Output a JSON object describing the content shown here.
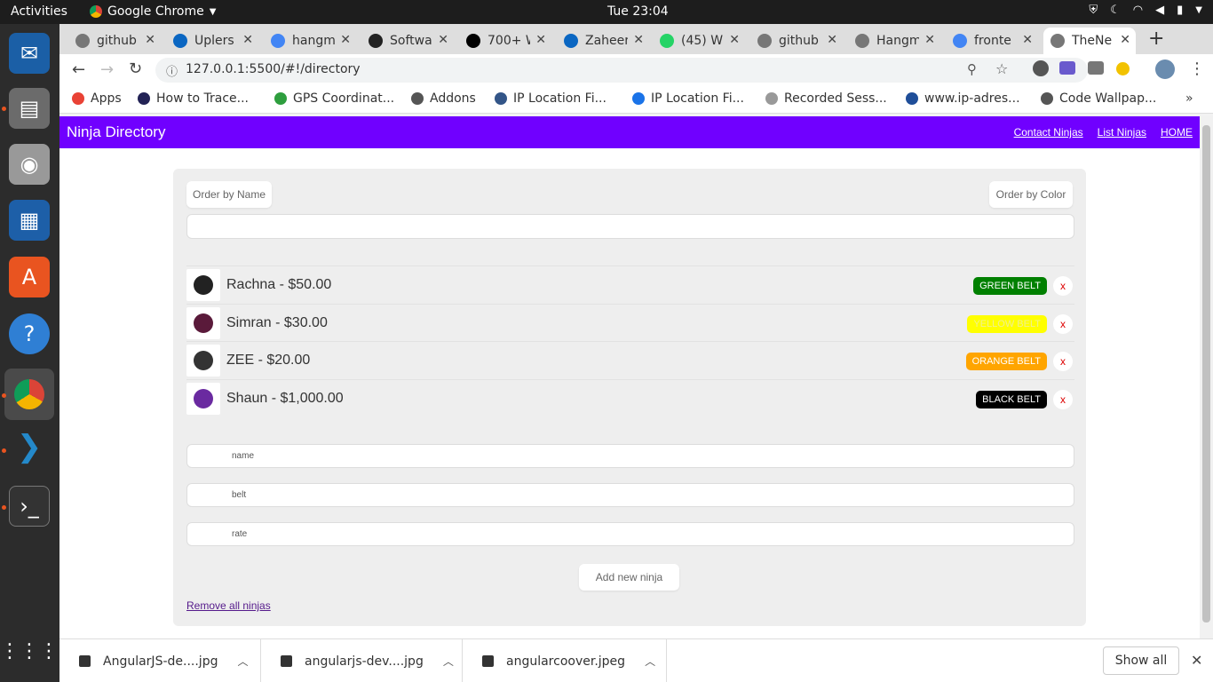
{
  "topbar": {
    "activities": "Activities",
    "app_name": "Google Chrome",
    "clock": "Tue 23:04"
  },
  "tabs": [
    {
      "label": "github",
      "icon": "globe-icon",
      "color": "#777777"
    },
    {
      "label": "Uplers",
      "icon": "linkedin-icon",
      "color": "#0a66c2"
    },
    {
      "label": "hangm",
      "icon": "google-icon",
      "color": "#4285f4"
    },
    {
      "label": "Softwa",
      "icon": "github-icon",
      "color": "#222222"
    },
    {
      "label": "700+ W",
      "icon": "dev-icon",
      "color": "#000000"
    },
    {
      "label": "Zaheer",
      "icon": "linkedin-icon",
      "color": "#0a66c2"
    },
    {
      "label": "(45) W",
      "icon": "whatsapp-icon",
      "color": "#25d366"
    },
    {
      "label": "github",
      "icon": "globe-icon",
      "color": "#777777"
    },
    {
      "label": "Hangm",
      "icon": "globe-icon",
      "color": "#777777"
    },
    {
      "label": "fronte",
      "icon": "google-icon",
      "color": "#4285f4"
    },
    {
      "label": "TheNe",
      "icon": "globe-icon",
      "color": "#777777",
      "active": true
    }
  ],
  "omnibox": {
    "url": "127.0.0.1:5500/#!/directory"
  },
  "bookmarks": [
    {
      "label": "Apps",
      "color": "#e94235"
    },
    {
      "label": "How to Trace...",
      "color": "#222255"
    },
    {
      "label": "GPS Coordinat...",
      "color": "#2e9e3e"
    },
    {
      "label": "Addons",
      "color": "#555555"
    },
    {
      "label": "IP Location Fi...",
      "color": "#335588"
    },
    {
      "label": "IP Location Fi...",
      "color": "#1a73e8"
    },
    {
      "label": "Recorded Sess...",
      "color": "#999999"
    },
    {
      "label": "www.ip-adres...",
      "color": "#1f4e99"
    },
    {
      "label": "Code Wallpap...",
      "color": "#555555"
    }
  ],
  "app": {
    "brand": "Ninja Directory",
    "nav": [
      "Contact Ninjas",
      "List Ninjas",
      "HOME"
    ],
    "order_by_name": "Order by Name",
    "order_by_color": "Order by Color",
    "search_value": "",
    "ninjas": [
      {
        "name": "Rachna",
        "rate": "$50.00",
        "belt": "GREEN BELT",
        "belt_bg": "#008000",
        "belt_fg": "#ffffff",
        "delete": "x"
      },
      {
        "name": "Simran",
        "rate": "$30.00",
        "belt": "YELLOW BELT",
        "belt_bg": "#ffff00",
        "belt_fg": "#f0f090",
        "delete": "x"
      },
      {
        "name": "ZEE",
        "rate": "$20.00",
        "belt": "ORANGE BELT",
        "belt_bg": "#ffa500",
        "belt_fg": "#ffffff",
        "delete": "x"
      },
      {
        "name": "Shaun",
        "rate": "$1,000.00",
        "belt": "BLACK BELT",
        "belt_bg": "#000000",
        "belt_fg": "#ffffff",
        "delete": "x"
      }
    ],
    "placeholders": {
      "name": "name",
      "belt": "belt",
      "rate": "rate"
    },
    "add_button": "Add new ninja",
    "remove_all": "Remove all ninjas"
  },
  "downloads": {
    "items": [
      "AngularJS-de....jpg",
      "angularjs-dev....jpg",
      "angularcoover.jpeg"
    ],
    "show_all": "Show all"
  }
}
